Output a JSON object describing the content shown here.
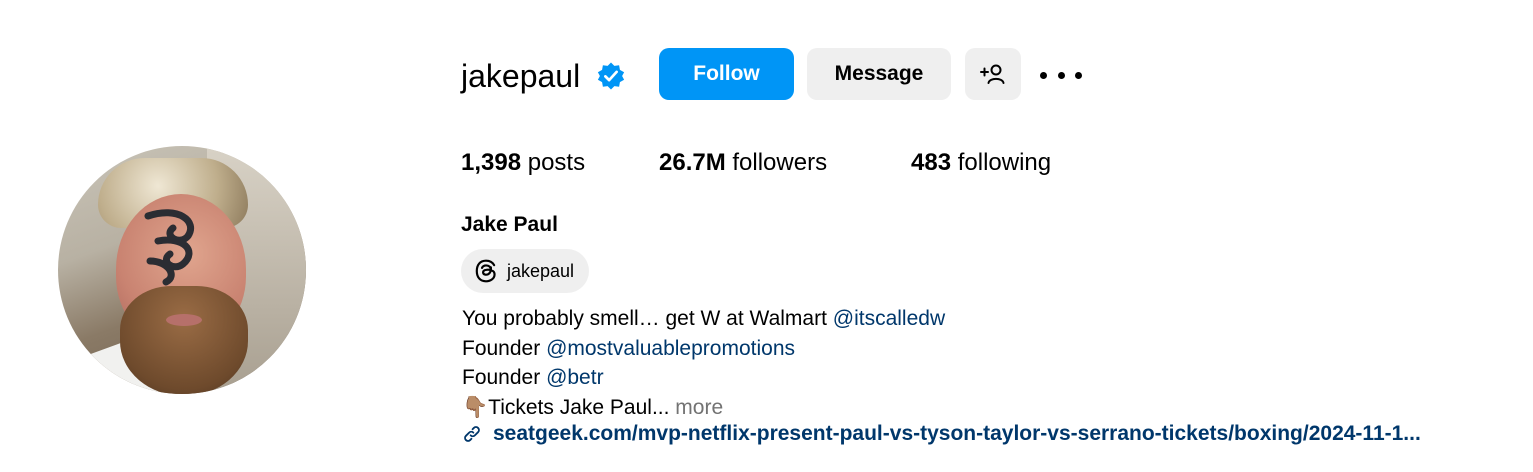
{
  "profile": {
    "username": "jakepaul",
    "verified": true,
    "verified_icon": "verified-badge-icon",
    "full_name": "Jake Paul",
    "avatar_icon": "profile-photo"
  },
  "actions": {
    "follow_label": "Follow",
    "message_label": "Message",
    "add_user_icon": "person-add-icon",
    "more_icon": "more-options-icon"
  },
  "stats": {
    "posts_count": "1,398",
    "posts_label": "posts",
    "followers_count": "26.7M",
    "followers_label": "followers",
    "following_count": "483",
    "following_label": "following"
  },
  "threads": {
    "icon": "threads-icon",
    "handle": "jakepaul"
  },
  "bio": {
    "line1_text": "You probably smell… get W at Walmart ",
    "line1_mention": "@itscalledw",
    "line2_text": "Founder ",
    "line2_mention": "@mostvaluablepromotions",
    "line3_text": "Founder ",
    "line3_mention": "@betr",
    "line4_emoji": "👇🏽",
    "line4_text": "Tickets Jake Paul... ",
    "more_label": "more",
    "link_icon": "link-icon",
    "link_text": "seatgeek.com/mvp-netflix-present-paul-vs-tyson-taylor-vs-serrano-tickets/boxing/2024-11-1..."
  },
  "colors": {
    "follow_button": "#0095f6",
    "secondary_button": "#efefef",
    "mention": "#00376b",
    "muted": "#737373",
    "verified": "#0095f6"
  }
}
